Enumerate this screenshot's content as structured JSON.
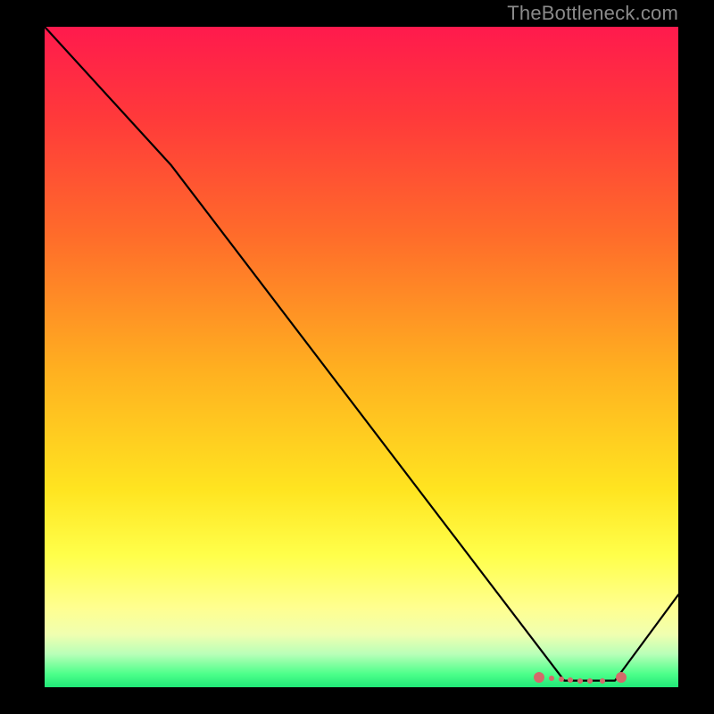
{
  "watermark": "TheBottleneck.com",
  "colors": {
    "background": "#000000",
    "watermark": "#8a8a8a",
    "curve": "#000000",
    "marker": "#d46a6a",
    "gradient_top": "#ff1a4d",
    "gradient_bottom": "#20e878"
  },
  "chart_data": {
    "type": "line",
    "title": "",
    "xlabel": "",
    "ylabel": "",
    "xlim": [
      0,
      100
    ],
    "ylim": [
      0,
      100
    ],
    "grid": false,
    "legend": false,
    "series": [
      {
        "name": "curve",
        "x": [
          0,
          20,
          82,
          90,
          100
        ],
        "values": [
          100,
          79,
          1,
          1,
          14
        ]
      }
    ],
    "markers": [
      {
        "x": 78,
        "y": 1.5,
        "size": "big"
      },
      {
        "x": 80,
        "y": 1.3,
        "size": "small"
      },
      {
        "x": 81.5,
        "y": 1.2,
        "size": "small"
      },
      {
        "x": 83,
        "y": 1.1,
        "size": "small"
      },
      {
        "x": 84.5,
        "y": 1.0,
        "size": "small"
      },
      {
        "x": 86,
        "y": 1.0,
        "size": "small"
      },
      {
        "x": 88,
        "y": 1.0,
        "size": "small"
      },
      {
        "x": 91,
        "y": 1.5,
        "size": "big"
      }
    ]
  }
}
